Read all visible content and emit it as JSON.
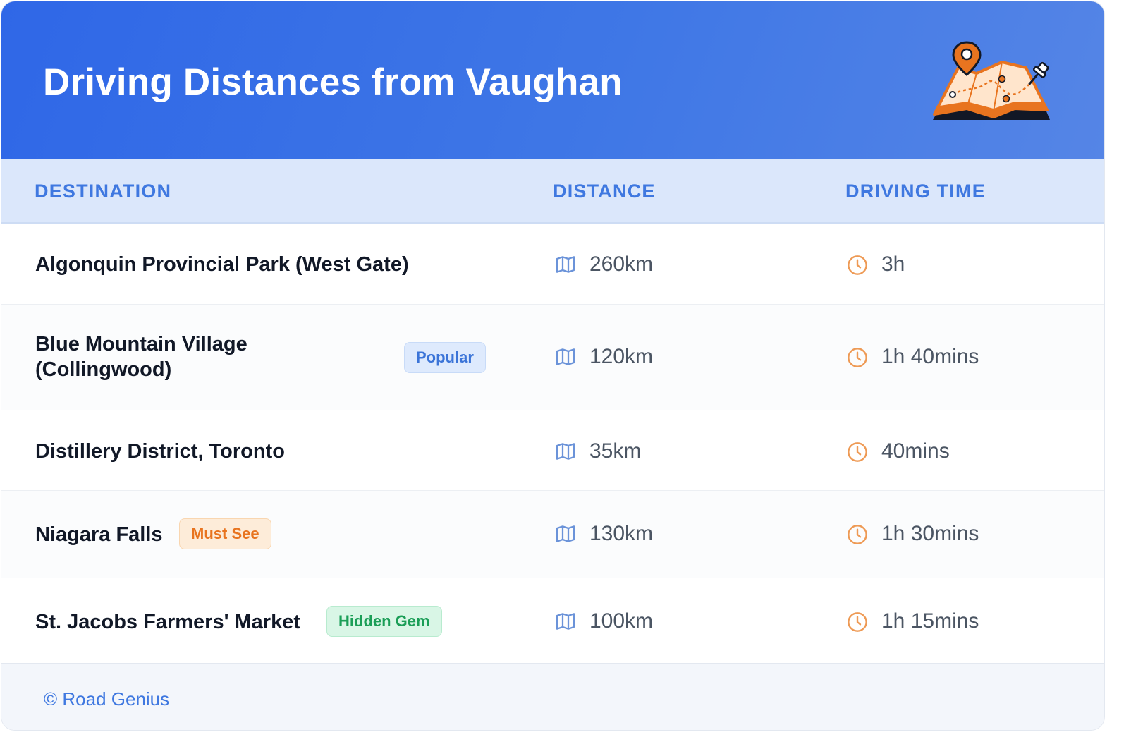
{
  "header": {
    "title": "Driving Distances from Vaughan",
    "illustration_icon": "map-with-pins-icon"
  },
  "table": {
    "columns": [
      "DESTINATION",
      "DISTANCE",
      "DRIVING TIME"
    ],
    "rows": [
      {
        "destination": "Algonquin Provincial Park (West Gate)",
        "badge": "",
        "distance": "260km",
        "time": "3h"
      },
      {
        "destination": "Blue Mountain Village\n(Collingwood)",
        "badge": "Popular",
        "distance": "120km",
        "time": "1h 40mins"
      },
      {
        "destination": "Distillery District, Toronto",
        "badge": "",
        "distance": "35km",
        "time": "40mins"
      },
      {
        "destination": "Niagara Falls",
        "badge": "Must See",
        "distance": "130km",
        "time": "1h 30mins"
      },
      {
        "destination": "St. Jacobs Farmers' Market",
        "badge": "Hidden Gem",
        "distance": "100km",
        "time": "1h 15mins"
      }
    ],
    "distance_icon": "map-icon",
    "time_icon": "clock-icon"
  },
  "footer": {
    "credit": "© Road Genius"
  },
  "colors": {
    "header_start": "#2f67e7",
    "header_end": "#5585e6",
    "accent_blue": "#3f78e0",
    "accent_orange": "#e8741f",
    "accent_green": "#1b9e57"
  }
}
